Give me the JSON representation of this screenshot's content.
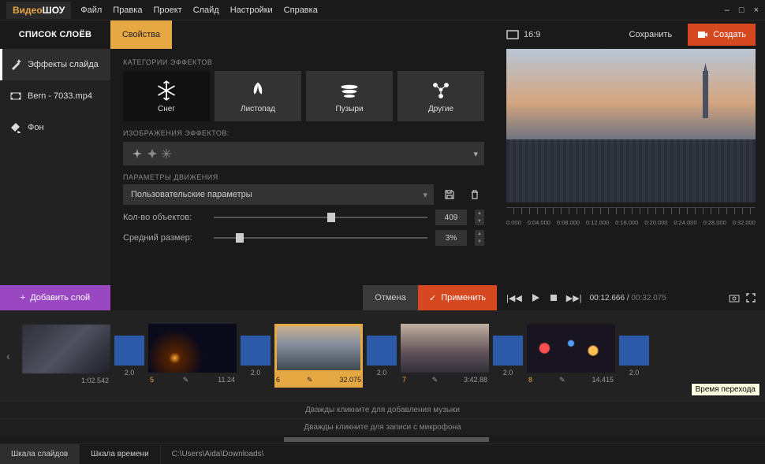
{
  "app": {
    "logo1": "Видео",
    "logo2": "ШОУ"
  },
  "menu": {
    "file": "Файл",
    "edit": "Правка",
    "project": "Проект",
    "slide": "Слайд",
    "settings": "Настройки",
    "help": "Справка"
  },
  "tabs": {
    "layers": "СПИСОК СЛОЁВ",
    "props": "Свойства"
  },
  "layers": {
    "effects": "Эффекты слайда",
    "clip": "Bern - 7033.mp4",
    "bg": "Фон"
  },
  "props": {
    "cat_label": "КАТЕГОРИИ ЭФФЕКТОВ",
    "cats": {
      "snow": "Снег",
      "leaves": "Листопад",
      "bubbles": "Пузыри",
      "other": "Другие"
    },
    "img_label": "ИЗОБРАЖЕНИЯ ЭФФЕКТОВ:",
    "motion_label": "ПАРАМЕТРЫ ДВИЖЕНИЯ",
    "preset": "Пользовательские параметры",
    "count_label": "Кол-во объектов:",
    "count_value": "409",
    "size_label": "Средний размер:",
    "size_value": "3%"
  },
  "actions": {
    "add_layer": "Добавить слой",
    "cancel": "Отмена",
    "apply": "Применить"
  },
  "preview": {
    "aspect": "16:9",
    "save": "Сохранить",
    "create": "Создать",
    "time_current": "00:12.666",
    "time_total": "00:32.075",
    "ruler": [
      "0.000",
      "0:04.000",
      "0:08.000",
      "0:12.000",
      "0:16.000",
      "0:20.000",
      "0:24.000",
      "0:28.000",
      "0:32.000"
    ]
  },
  "thumbs": {
    "t1_dur": "1:02.542",
    "tr1": "2.0",
    "t2_num": "5",
    "t2_dur": "11.24",
    "tr2": "2.0",
    "t3_num": "6",
    "t3_dur": "32.075",
    "tr3": "2.0",
    "t4_num": "7",
    "t4_dur": "3:42.88",
    "tr4": "2.0",
    "t5_num": "8",
    "t5_dur": "14.415",
    "tr5": "2.0",
    "tooltip": "Время перехода"
  },
  "tracks": {
    "music": "Дважды кликните для добавления музыки",
    "mic": "Дважды кликните для записи с микрофона"
  },
  "bottom": {
    "tab1": "Шкала слайдов",
    "tab2": "Шкала времени",
    "path": "C:\\Users\\Aida\\Downloads\\"
  }
}
